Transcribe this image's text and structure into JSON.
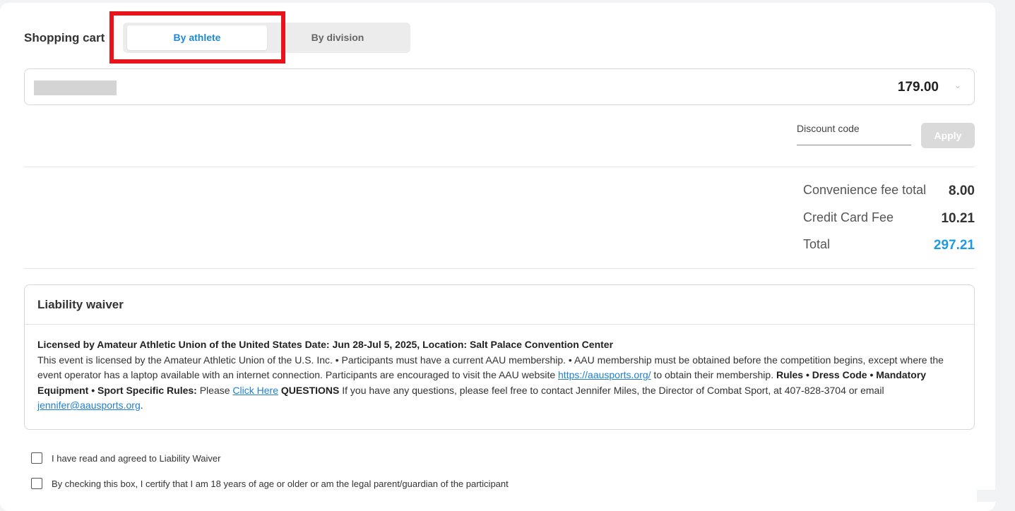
{
  "header": {
    "title": "Shopping cart"
  },
  "tabs": {
    "by_athlete": "By athlete",
    "by_division": "By division"
  },
  "cart": {
    "amount": "179.00",
    "chevron": "chevron-down-icon"
  },
  "discount": {
    "placeholder": "Discount code",
    "apply_label": "Apply"
  },
  "fees": {
    "convenience_label": "Convenience fee total",
    "convenience_value": "8.00",
    "credit_label": "Credit Card Fee",
    "credit_value": "10.21",
    "total_label": "Total",
    "total_value": "297.21"
  },
  "waiver": {
    "title": "Liability waiver",
    "heading": "Licensed by Amateur Athletic Union of the United States Date: Jun 28-Jul 5, 2025, Location: Salt Palace Convention Center",
    "text1": "This event is licensed by the Amateur Athletic Union of the U.S. Inc. • Participants must have a current AAU membership. • AAU membership must be obtained before the competition begins, except where the event operator has a laptop available with an internet connection. Participants are encouraged to visit the AAU website ",
    "link1": "https://aausports.org/",
    "text2": " to obtain their membership. ",
    "bold1": "Rules • Dress Code • Mandatory Equipment • Sport Specific Rules:",
    "text3": " Please ",
    "link2": "Click Here",
    "text4": " ",
    "bold2": "QUESTIONS",
    "text5": " If you have any questions, please feel free to contact Jennifer Miles, the Director of Combat Sport, at 407-828-3704 or email ",
    "link3": "jennifer@aausports.org",
    "text6": "."
  },
  "checks": {
    "agree_label": "I have read and agreed to Liability Waiver",
    "age_label": "By checking this box, I certify that I am 18 years of age or older or am the legal parent/guardian of the participant"
  },
  "colors": {
    "accent": "#1e9be0",
    "highlight": "#e8141b"
  }
}
